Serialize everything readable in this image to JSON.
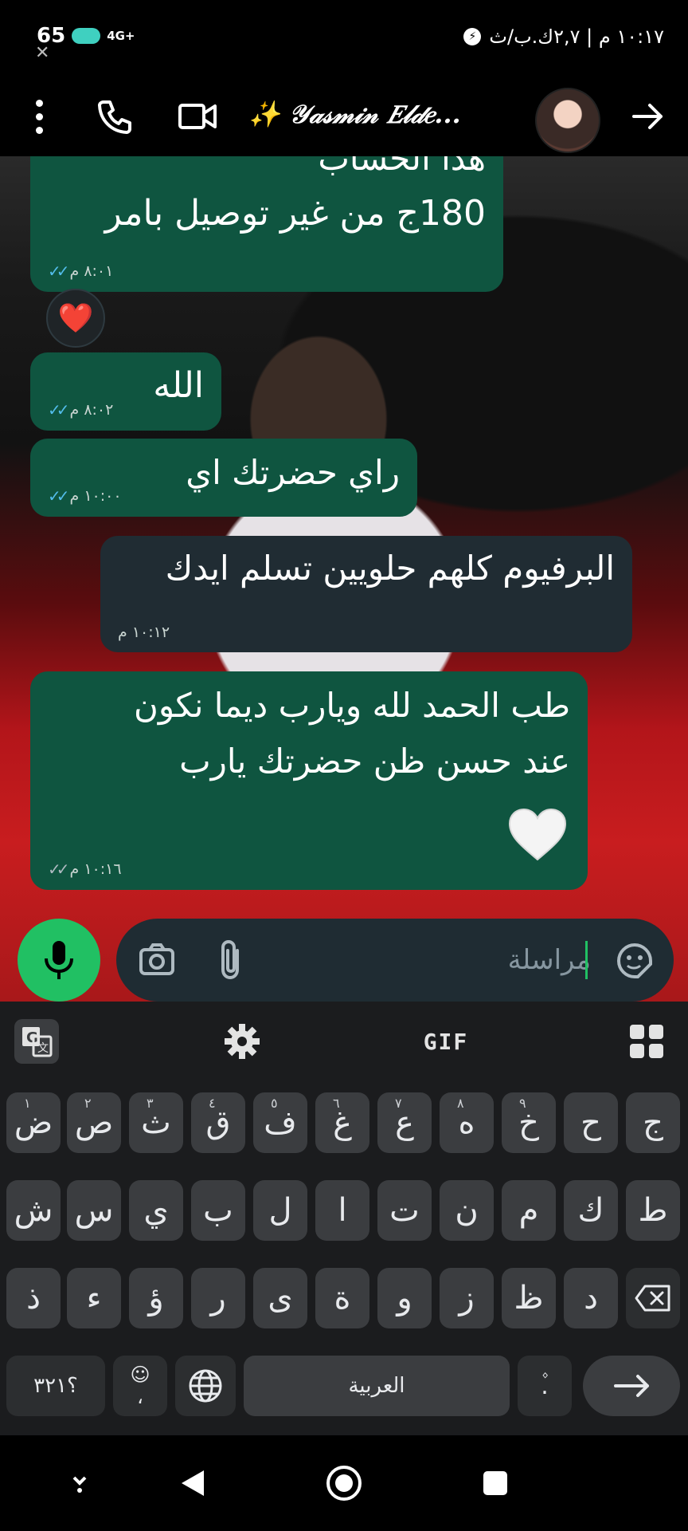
{
  "status_bar": {
    "battery": "65",
    "network": "4G+",
    "right_text": "١٠:١٧ م | ٢,٧ك.ب/ث",
    "messenger_icon": "messenger-icon",
    "overlay_app_icon": "capcut-icon"
  },
  "header": {
    "contact_name": "✨ 𝒴𝒶𝓈𝓂𝒾𝓃 𝐸𝓁𝒹𝑒...",
    "icons": [
      "more-vert-icon",
      "phone-icon",
      "video-call-icon",
      "arrow-right-icon"
    ]
  },
  "messages": [
    {
      "type": "out",
      "lines": [
        "هذا الحساب",
        "180ج من غير توصيل بامر"
      ],
      "time": "٨:٠١ م",
      "status": "read"
    },
    {
      "type": "reaction",
      "emoji": "❤️"
    },
    {
      "type": "out",
      "lines": [
        "الله"
      ],
      "time": "٨:٠٢ م",
      "status": "read"
    },
    {
      "type": "out",
      "lines": [
        "راي حضرتك اي"
      ],
      "time": "١٠:٠٠ م",
      "status": "read"
    },
    {
      "type": "in",
      "lines": [
        "البرفيوم كلهم حلويين تسلم ايدك"
      ],
      "time": "١٠:١٢ م"
    },
    {
      "type": "out",
      "lines": [
        "طب الحمد لله ويارب ديما نكون",
        "عند حسن ظن حضرتك يارب"
      ],
      "emoji": "🤍",
      "time": "١٠:١٦ م",
      "status": "delivered"
    }
  ],
  "composer": {
    "placeholder": "مراسلة",
    "icons": [
      "sticker-icon",
      "attach-icon",
      "camera-icon",
      "mic-icon"
    ]
  },
  "keyboard": {
    "toolbar": {
      "gif_label": "GIF",
      "icons": [
        "translate-icon",
        "settings-icon",
        "apps-grid-icon"
      ]
    },
    "row1": [
      {
        "k": "ج"
      },
      {
        "k": "ح"
      },
      {
        "k": "خ",
        "h": "٩"
      },
      {
        "k": "ه",
        "h": "٨"
      },
      {
        "k": "ع",
        "h": "٧"
      },
      {
        "k": "غ",
        "h": "٦"
      },
      {
        "k": "ف",
        "h": "٥"
      },
      {
        "k": "ق",
        "h": "٤"
      },
      {
        "k": "ث",
        "h": "٣"
      },
      {
        "k": "ص",
        "h": "٢"
      },
      {
        "k": "ض",
        "h": "١"
      }
    ],
    "row2": [
      "ط",
      "ك",
      "م",
      "ن",
      "ت",
      "ا",
      "ل",
      "ب",
      "ي",
      "س",
      "ش"
    ],
    "row3": [
      "د",
      "ظ",
      "ز",
      "و",
      "ة",
      "ى",
      "ر",
      "ؤ",
      "ء",
      "ذ"
    ],
    "space_label": "العربية",
    "symbols_label": "؟٣٢١",
    "emoji_key": "☺",
    "comma_key": "،",
    "period_key": "۫.",
    "enter_label": "↩"
  },
  "navbar": {
    "icons": [
      "keyboard-hide-icon",
      "back-icon",
      "home-icon",
      "recents-icon"
    ]
  }
}
